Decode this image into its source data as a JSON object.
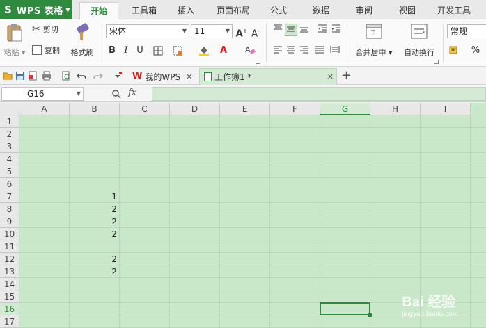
{
  "app": {
    "name": "WPS 表格",
    "logo": "S"
  },
  "menu": {
    "tabs": [
      "开始",
      "工具箱",
      "插入",
      "页面布局",
      "公式",
      "数据",
      "审阅",
      "视图",
      "开发工具"
    ],
    "active": 0
  },
  "ribbon": {
    "paste": "粘贴",
    "cut": "剪切",
    "copy": "复制",
    "format_painter": "格式刷",
    "font_name": "宋体",
    "font_size": "11",
    "bold": "B",
    "italic": "I",
    "underline": "U",
    "merge_center": "合并居中",
    "wrap_text": "自动换行",
    "number_format": "常规",
    "percent": "%",
    "font_color": "#d42020",
    "fill_color": "#f7d300"
  },
  "doc_tabs": [
    {
      "label": "我的WPS",
      "active": false
    },
    {
      "label": "工作簿1 *",
      "active": true
    }
  ],
  "formula_bar": {
    "cell_ref": "G16",
    "fx": "fx"
  },
  "sheet": {
    "columns": [
      "A",
      "B",
      "C",
      "D",
      "E",
      "F",
      "G",
      "H",
      "I"
    ],
    "rows": [
      "1",
      "2",
      "3",
      "4",
      "5",
      "6",
      "7",
      "8",
      "9",
      "10",
      "11",
      "12",
      "13",
      "14",
      "15",
      "16",
      "17"
    ],
    "active_col": "G",
    "active_row": "16",
    "cells": [
      {
        "col": "B",
        "row": "7",
        "value": "1"
      },
      {
        "col": "B",
        "row": "8",
        "value": "2"
      },
      {
        "col": "B",
        "row": "9",
        "value": "2"
      },
      {
        "col": "B",
        "row": "10",
        "value": "2"
      },
      {
        "col": "B",
        "row": "12",
        "value": "2"
      },
      {
        "col": "B",
        "row": "13",
        "value": "2"
      }
    ]
  },
  "watermark": {
    "brand": "Bai 经验",
    "url": "jingyan.baidu.com"
  },
  "colors": {
    "accent": "#2e8b3e",
    "grid_bg": "#c9e8c9"
  }
}
